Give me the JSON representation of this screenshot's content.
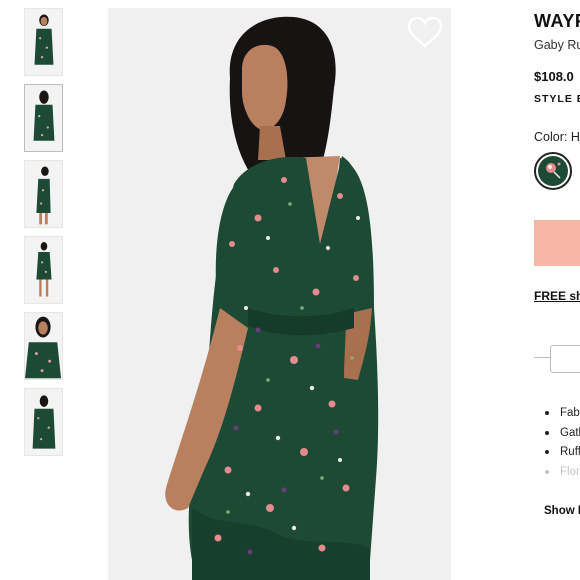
{
  "gallery": {
    "thumbnails": [
      {
        "view": "front"
      },
      {
        "view": "back",
        "active": true
      },
      {
        "view": "side"
      },
      {
        "view": "full-length"
      },
      {
        "view": "detail-top"
      },
      {
        "view": "flat"
      }
    ],
    "main_image": {
      "alt_view": "back"
    },
    "wishlist_icon": "heart-outline-icon"
  },
  "product": {
    "brand": "WAYF",
    "designer": "Gaby Ru",
    "price": "$108.0",
    "style_code": "STYLE E",
    "color_label": "Color: H",
    "swatch_icon": "floral-swatch",
    "add_button_color": "#f8b7a6",
    "shipping": "FREE shi",
    "details": [
      {
        "text": "Fab",
        "faded": false
      },
      {
        "text": "Gatl",
        "faded": false
      },
      {
        "text": "Ruff",
        "faded": false
      },
      {
        "text": "Flor",
        "faded": true
      }
    ],
    "show_more": "Show M"
  },
  "colors": {
    "dress_green": "#1c4a35",
    "skin": "#b98060",
    "hair": "#161312",
    "background": "#f0f0f0"
  }
}
